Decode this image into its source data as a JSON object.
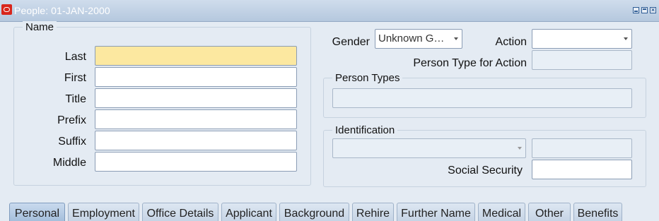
{
  "window": {
    "title": "People: 01-JAN-2000"
  },
  "name_group": {
    "title": "Name",
    "last_label": "Last",
    "first_label": "First",
    "title_label": "Title",
    "prefix_label": "Prefix",
    "suffix_label": "Suffix",
    "middle_label": "Middle"
  },
  "gender": {
    "label": "Gender",
    "value": "Unknown G…"
  },
  "action": {
    "label": "Action",
    "value": ""
  },
  "person_type_for_action": {
    "label": "Person Type for Action"
  },
  "person_types": {
    "title": "Person Types"
  },
  "identification": {
    "title": "Identification",
    "social_security_label": "Social Security"
  },
  "tabs": [
    {
      "label": "Personal",
      "active": true
    },
    {
      "label": "Employment"
    },
    {
      "label": "Office Details"
    },
    {
      "label": "Applicant"
    },
    {
      "label": "Background"
    },
    {
      "label": "Rehire"
    },
    {
      "label": "Further Name"
    },
    {
      "label": "Medical"
    },
    {
      "label": "Other"
    },
    {
      "label": "Benefits"
    }
  ],
  "colors": {
    "focus_field": "#fce8a0",
    "titlebar": "#b5c8de",
    "background": "#e4ebf3"
  }
}
